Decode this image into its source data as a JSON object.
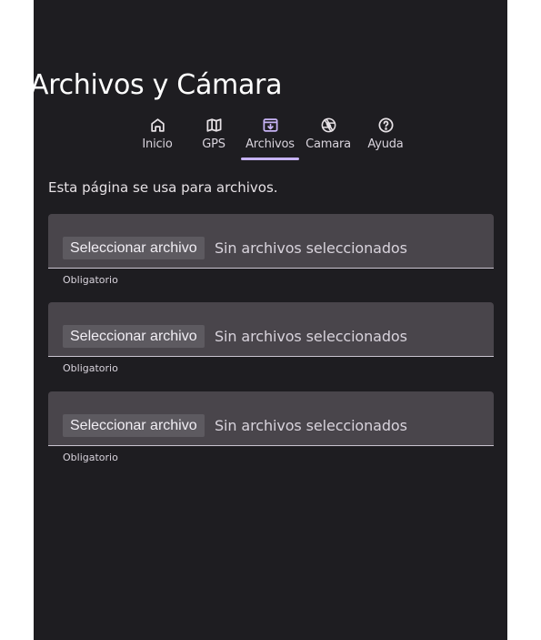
{
  "page": {
    "title": "Archivos y Cámara"
  },
  "tabs": [
    {
      "label": "Inicio",
      "icon": "home-icon",
      "active": false
    },
    {
      "label": "GPS",
      "icon": "map-icon",
      "active": false
    },
    {
      "label": "Archivos",
      "icon": "archive-download-icon",
      "active": true
    },
    {
      "label": "Camara",
      "icon": "camera-aperture-icon",
      "active": false
    },
    {
      "label": "Ayuda",
      "icon": "help-circle-icon",
      "active": false
    }
  ],
  "content": {
    "intro": "Esta página se usa para archivos.",
    "file_fields": [
      {
        "button_label": "Seleccionar archivo",
        "status": "Sin archivos seleccionados",
        "helper": "Obligatorio"
      },
      {
        "button_label": "Seleccionar archivo",
        "status": "Sin archivos seleccionados",
        "helper": "Obligatorio"
      },
      {
        "button_label": "Seleccionar archivo",
        "status": "Sin archivos seleccionados",
        "helper": "Obligatorio"
      }
    ]
  },
  "colors": {
    "background": "#1e1d21",
    "field_fill": "#49454b",
    "active_tab_indicator": "#c7b3f5",
    "text": "#e6e1e5"
  }
}
